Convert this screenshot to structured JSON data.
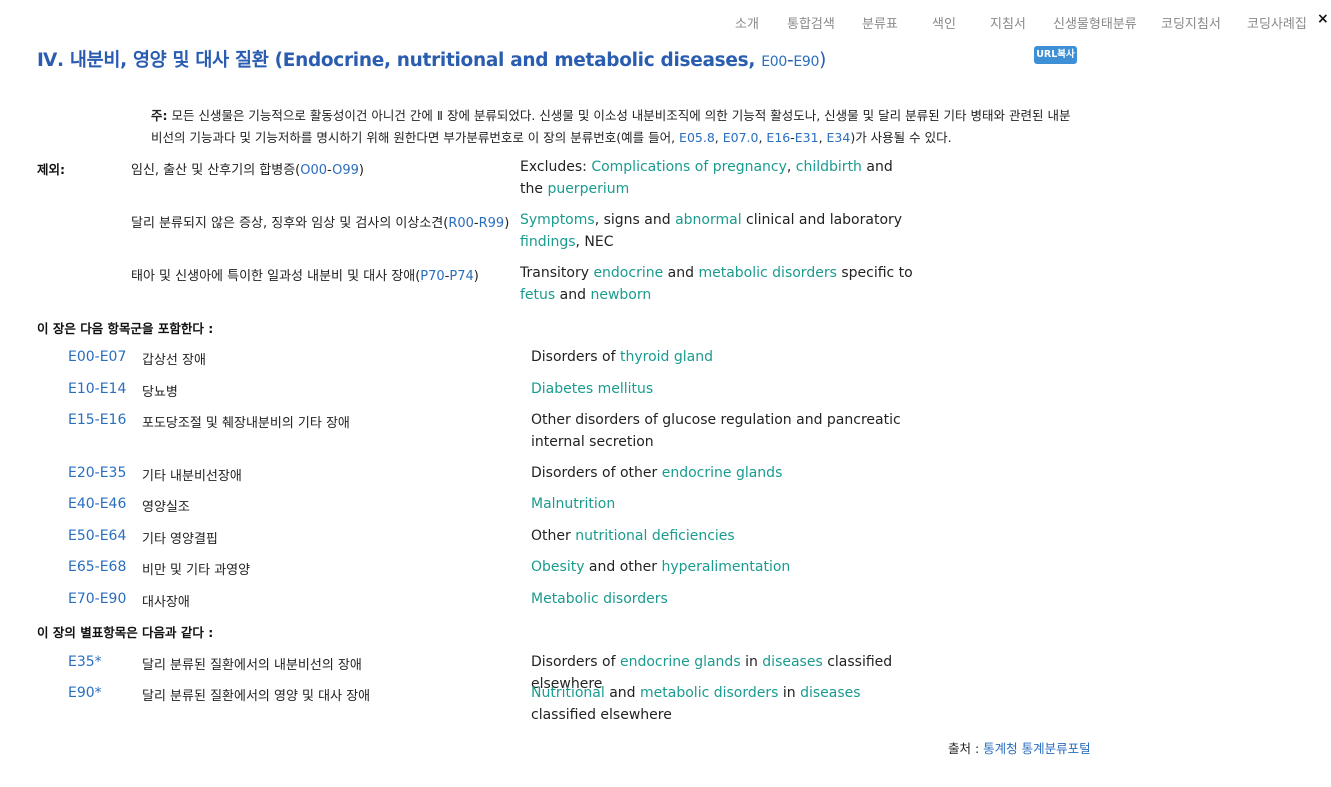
{
  "nav": {
    "items": [
      "소개",
      "통합검색",
      "분류표",
      "색인",
      "지침서",
      "신생물형태분류",
      "코딩지침서",
      "코딩사례집"
    ],
    "close": "×"
  },
  "chapter": {
    "roman": "Ⅳ.",
    "title_ko": "내분비, 영양 및 대사 질환",
    "title_en": "(Endocrine, nutritional and metabolic diseases,",
    "code_start": "E00",
    "dash": "-",
    "code_end": "E90",
    "close_paren": ")",
    "url_button": "URL복사"
  },
  "note": {
    "label": "주:",
    "text_a": "모든 신생물은 기능적으로 활동성이건 아니건 간에 Ⅱ 장에 분류되었다. 신생물 및 이소성 내분비조직에 의한 기능적 활성도나, 신생물 및 달리 분류된 기타 병태와 관련된 내분비선의 기능과다 및 기능저하를 명시하기 위해 원한다면 부가분류번호로 이 장의 분류번호(예를 들어, ",
    "codes": [
      "E05.8",
      "E07.0",
      "E16",
      "E31",
      "E34"
    ],
    "text_b": ")가 사용될 수 있다."
  },
  "excludes": {
    "label": "제외:",
    "items": [
      {
        "ko": "임신, 출산 및 산후기의 합병증(",
        "code_a": "O00",
        "code_b": "O99",
        "en_prefix": "Excludes: ",
        "en": [
          "Complications of pregnancy",
          ", ",
          "childbirth",
          " and the ",
          "puerperium"
        ]
      },
      {
        "ko": "달리 분류되지 않은 증상, 징후와 임상 및 검사의 이상소견(",
        "code_a": "R00",
        "code_b": "R99",
        "en": [
          "Symptoms",
          ", signs and ",
          "abnormal",
          " clinical and laboratory ",
          "findings",
          ", NEC"
        ]
      },
      {
        "ko": "태아 및 신생아에 특이한 일과성 내분비 및 대사 장애(",
        "code_a": "P70",
        "code_b": "P74",
        "en": [
          "Transitory ",
          "endocrine",
          " and ",
          "metabolic disorders",
          " specific to ",
          "fetus",
          " and ",
          "newborn"
        ]
      }
    ]
  },
  "blocks": {
    "heading": "이 장은 다음 항목군을 포함한다 :",
    "rows": [
      {
        "range": "E00-E07",
        "ko": "갑상선 장애",
        "en": [
          "Disorders of ",
          "thyroid gland"
        ]
      },
      {
        "range": "E10-E14",
        "ko": "당뇨병",
        "en": [
          "",
          "Diabetes mellitus"
        ]
      },
      {
        "range": "E15-E16",
        "ko": "포도당조절 및 췌장내분비의 기타 장애",
        "en": [
          "Other disorders of glucose regulation and pancreatic internal secretion"
        ]
      },
      {
        "range": "E20-E35",
        "ko": "기타 내분비선장애",
        "en": [
          "Disorders of other ",
          "endocrine glands"
        ]
      },
      {
        "range": "E40-E46",
        "ko": "영양실조",
        "en": [
          "",
          "Malnutrition"
        ]
      },
      {
        "range": "E50-E64",
        "ko": "기타 영양결핍",
        "en": [
          "Other ",
          "nutritional deficiencies"
        ]
      },
      {
        "range": "E65-E68",
        "ko": "비만 및 기타 과영양",
        "en": [
          "",
          "Obesity",
          " and other ",
          "hyperalimentation"
        ]
      },
      {
        "range": "E70-E90",
        "ko": "대사장애",
        "en": [
          "",
          "Metabolic disorders"
        ]
      }
    ]
  },
  "asterisk": {
    "heading": "이 장의 별표항목은 다음과 같다 :",
    "rows": [
      {
        "code": "E35*",
        "ko": "달리 분류된 질환에서의 내분비선의 장애",
        "en": [
          "Disorders of ",
          "endocrine glands",
          " in ",
          "diseases",
          " classified elsewhere"
        ]
      },
      {
        "code": "E90*",
        "ko": "달리 분류된 질환에서의 영양 및 대사 장애",
        "en": [
          "",
          "Nutritional",
          " and ",
          "metabolic disorders",
          " in ",
          "diseases",
          " classified elsewhere"
        ]
      }
    ]
  },
  "source": {
    "label": "출처 : ",
    "link": "통계청 통계분류포털"
  },
  "colors": {
    "title_blue": "#2a5db0",
    "code_blue": "#2a6ebf",
    "link_teal": "#1a9b8f",
    "button_blue": "#3d8fd6",
    "nav_gray": "#8a8a8a"
  }
}
